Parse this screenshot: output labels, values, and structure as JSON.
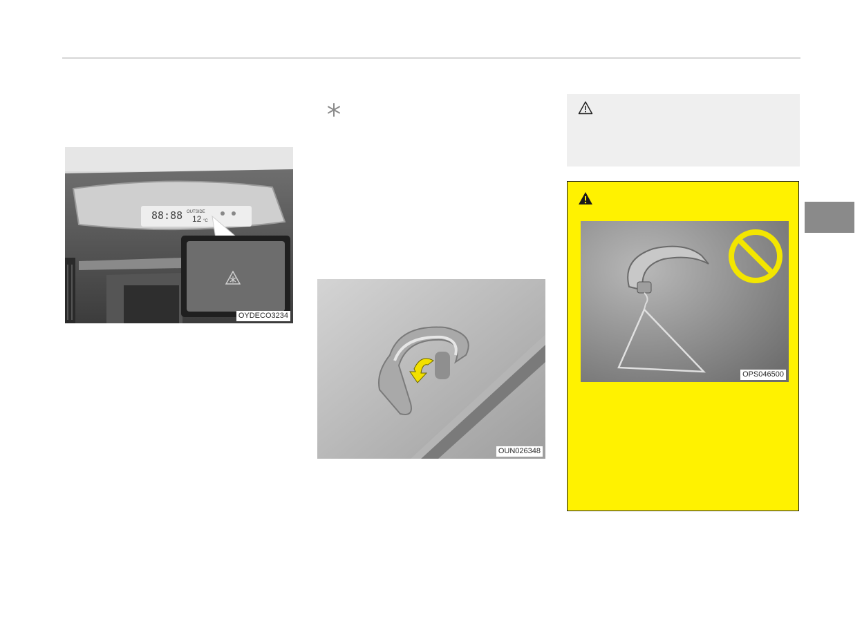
{
  "figures": {
    "dashboard": {
      "caption": "OYDECO3234",
      "clock_text": "88:88",
      "outside_label": "OUTSIDE",
      "temp_text": "12",
      "temp_unit": "°C"
    },
    "grab_handle": {
      "caption": "OUN026348"
    },
    "coat_hook_warning": {
      "caption": "OPS046500"
    }
  },
  "icons": {
    "note_marker": "asterisk-icon",
    "caution": "caution-triangle-icon",
    "warning": "warning-triangle-icon",
    "prohibited": "prohibited-icon",
    "road_ice": "road-ice-warning-icon"
  },
  "colors": {
    "warning_background": "#fff200",
    "note_background": "#efefef",
    "section_tab": "#8a8a8a",
    "prohibited_sign": "#f3e600"
  }
}
